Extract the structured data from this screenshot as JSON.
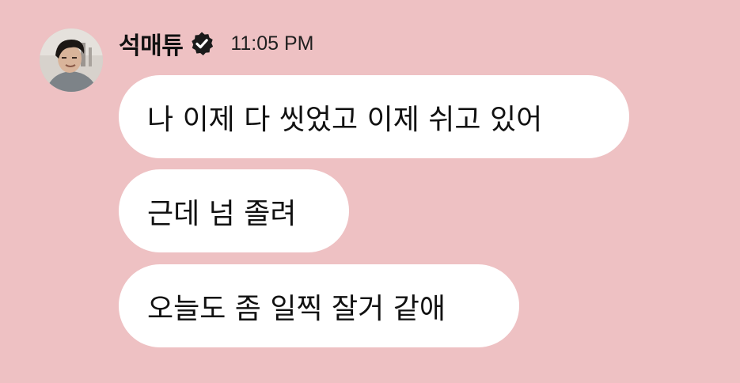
{
  "header": {
    "sender_name": "석매튜",
    "timestamp": "11:05 PM",
    "verified_badge_icon": "verified-badge-icon"
  },
  "messages": [
    {
      "text": "나 이제 다 씻었고 이제 쉬고 있어"
    },
    {
      "text": "근데 넘 졸려"
    },
    {
      "text": "오늘도 좀 일찍 잘거 같애"
    }
  ],
  "colors": {
    "background": "#eec1c3",
    "bubble": "#ffffff",
    "text": "#111111",
    "badge": "#1a1a1a"
  }
}
